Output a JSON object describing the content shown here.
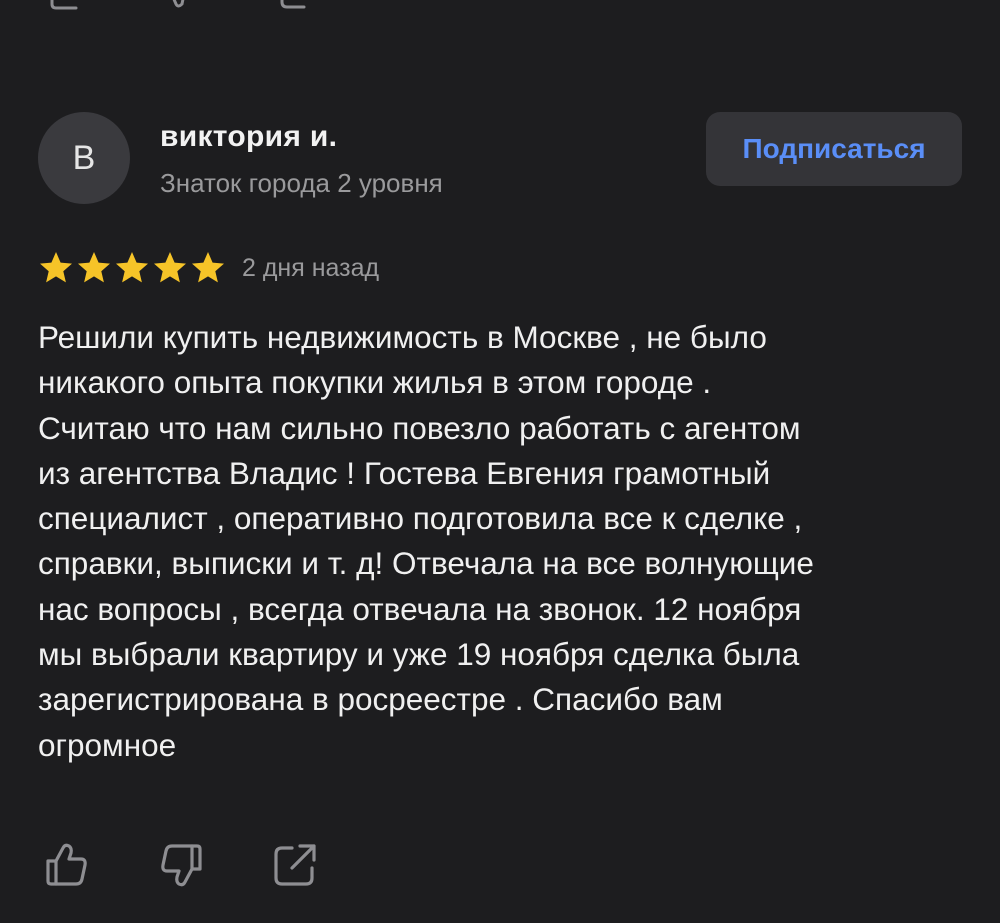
{
  "review": {
    "author": {
      "initial": "В",
      "name": "виктория и.",
      "level": "Знаток города 2 уровня"
    },
    "subscribe_label": "Подписаться",
    "rating": 5,
    "rating_max": 5,
    "date": "2 дня назад",
    "text": "Решили купить недвижимость в Москве , не было\nникакого опыта покупки жилья в этом городе .\nСчитаю что нам сильно повезло работать с агентом\nиз агентства Владис ! Гостева Евгения грамотный\nспециалист , оперативно подготовила все к сделке ,\nсправки, выписки и т. д! Отвечала на все волнующие\nнас вопросы , всегда отвечала на звонок. 12 ноября\nмы выбрали квартиру и уже 19 ноября сделка была\nзарегистрирована  в росреестре . Спасибо вам\nогромное"
  },
  "actions": [
    "thumbs-up-icon",
    "thumbs-down-icon",
    "share-icon"
  ],
  "colors": {
    "background": "#1d1d1f",
    "star": "#f6c428",
    "accent": "#5a8ef7",
    "button_bg": "#343438"
  }
}
